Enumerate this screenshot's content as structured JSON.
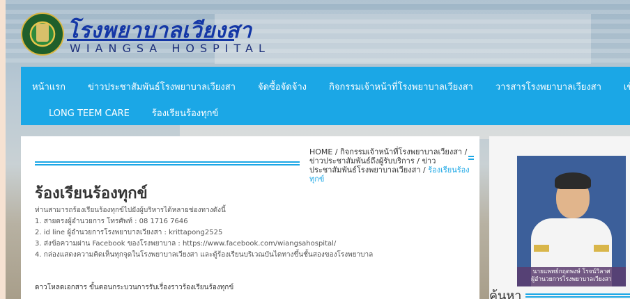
{
  "brand": {
    "thai_name": "โรงพยาบาลเวียงสา",
    "english_name": "WIANGSA HOSPITAL"
  },
  "nav": {
    "row1": [
      "หน้าแรก",
      "ข่าวประชาสัมพันธ์โรงพยาบาลเวียงสา",
      "จัดซื้อจัดจ้าง",
      "กิจกรรมเจ้าหน้าที่โรงพยาบาลเวียงสา",
      "วารสารโรงพยาบาลเวียงสา",
      "เข้าสู่ระบบ"
    ],
    "row2": [
      "LONG TEEM CARE",
      "ร้องเรียนร้องทุกข์"
    ]
  },
  "breadcrumb": {
    "items": [
      "HOME",
      "กิจกรรมเจ้าหน้าที่โรงพยาบาลเวียงสา",
      "ข่าวประชาสัมพันธ์ถึงผู้รับบริการ",
      "ข่าวประชาสัมพันธ์โรงพยาบาลเวียงสา"
    ],
    "current": "ร้องเรียนร้องทุกข์",
    "separator": "/"
  },
  "article": {
    "title": "ร้องเรียนร้องทุกข์",
    "intro": "ท่านสามารถร้องเรียนร้องทุกข์ไปยังผู้บริหารได้หลายช่องทางดังนี้",
    "lines": [
      "1. สายตรงผู้อำนวยการ โทรศัพท์ : 08 1716 7646",
      "2. id line ผู้อำนวยการโรงพยาบาลเวียงสา : krittapong2525",
      "3. ส่งข้อความผ่าน Facebook ของโรงพยาบาล : https://www.facebook.com/wiangsahospital/",
      "4. กล่องแสดงความคิดเห็นทุกจุดในโรงพยาบาลเวียงสา และตู้ร้องเรียนบริเวณบันไดทางขึ้นชั้นสองของโรงพยาบาล"
    ],
    "download_text": "ดาวโหลดเอกสาร ขั้นตอนกระบวนการรับเรื่องราวร้องเรียนร้องทุกข์"
  },
  "sidebar": {
    "photo_caption_name": "นายแพทย์กฤตพงษ์ โรจน์วิลาศ",
    "photo_caption_title": "ผู้อำนวยการโรงพยาบาลเวียงสา",
    "search_label": "ค้นหา"
  },
  "colors": {
    "accent": "#1ba7e6",
    "brand_blue": "#1437a6",
    "frame": "#f6e2d2"
  }
}
